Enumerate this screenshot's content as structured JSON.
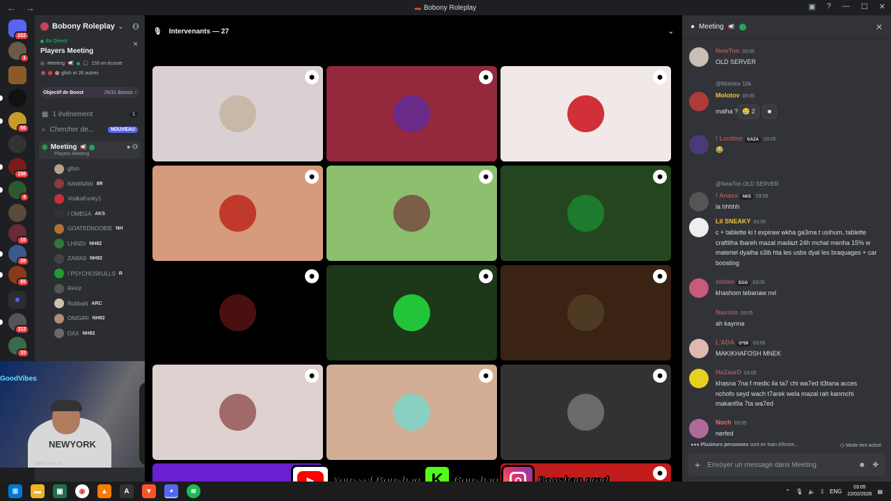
{
  "window": {
    "title": "Bobony Roleplay"
  },
  "server_rail": {
    "dm_badge": "222",
    "badges": [
      "1",
      "56",
      "158",
      "4",
      "10",
      "38",
      "55",
      "112",
      "33"
    ]
  },
  "sidebar": {
    "server_name": "Bobony Roleplay",
    "live": {
      "label": "En Direct",
      "title": "Players Meeting",
      "channel": "Meeting",
      "listeners": "155 en écoute",
      "participants": "gltxh et 26 autres"
    },
    "boost": {
      "label": "Objectif de Boost",
      "count": "25/31 Boosts"
    },
    "events": {
      "label": "1 événement",
      "count": "1"
    },
    "search": {
      "label": "Chercher de...",
      "badge": "NOUVEAU"
    },
    "voice_channel": {
      "name": "Meeting",
      "subtitle": "Players Meeting"
    },
    "voice_users": [
      {
        "name": "gltxh",
        "tag": "",
        "color": "#b9a08a"
      },
      {
        "name": "NAWNAW",
        "tag": "8R",
        "color": "#8a3b3b"
      },
      {
        "name": "VodkaFunky1",
        "tag": "",
        "color": "#c72f3a"
      },
      {
        "name": "! OMEGA",
        "tag": "AKS",
        "color": "#333333"
      },
      {
        "name": "GOATEDNOOBIE",
        "tag": "NH",
        "color": "#b07030"
      },
      {
        "name": "LHINDI",
        "tag": "NH82",
        "color": "#2d7b3b"
      },
      {
        "name": "ZAWA9",
        "tag": "NH82",
        "color": "#444444"
      },
      {
        "name": "! PSYCHOSKULLS",
        "tag": "R",
        "color": "#1e9e2e"
      },
      {
        "name": "Reviz",
        "tag": "",
        "color": "#555555"
      },
      {
        "name": "RobbaN",
        "tag": "ARC",
        "color": "#cfc1b0"
      },
      {
        "name": "ONIGIRI",
        "tag": "NH82",
        "color": "#ad8e7a"
      },
      {
        "name": "DAX",
        "tag": "NH82",
        "color": "#6a6a6a"
      }
    ]
  },
  "webcam": {
    "neon": "GoodVibes",
    "shirt": "NEWYORK",
    "status": "Dans une ca"
  },
  "stage": {
    "header": "Intervenants — 27",
    "tiles": [
      {
        "bg": "#d9d0d1",
        "av": "#c8b8a8"
      },
      {
        "bg": "#94283d",
        "av": "#6a2a8a"
      },
      {
        "bg": "#f1e9e7",
        "av": "#d13039"
      },
      {
        "bg": "#d69a7c",
        "av": "#c0392b"
      },
      {
        "bg": "#8cbf6e",
        "av": "#7a5e4a"
      },
      {
        "bg": "#24461f",
        "av": "#1e7a2e"
      },
      {
        "bg": "#000000",
        "av": "#4a0f0f"
      },
      {
        "bg": "#1d3818",
        "av": "#22c43a"
      },
      {
        "bg": "#3a2313",
        "av": "#4e3a22"
      },
      {
        "bg": "#ded1cf",
        "av": "#a06a6a"
      },
      {
        "bg": "#d4ad95",
        "av": "#8ad0c0"
      },
      {
        "bg": "#323232",
        "av": "#6a6a6a"
      }
    ]
  },
  "chat": {
    "title": "Meeting",
    "messages": [
      {
        "name": "NewTon",
        "color": "#a05a5a",
        "time": "03:05",
        "body": "OLD SERVER"
      },
      {
        "reply": "@Molotov 10k",
        "name": "Molotov",
        "color": "#f0c040",
        "time": "03:05",
        "body": "malha ?",
        "reaction": "🥲 2"
      },
      {
        "name": "! Lordino",
        "tag": "GAZA",
        "color": "#a05a5a",
        "time": "03:05",
        "body": "😂"
      },
      {
        "reply": "@NewTon OLD SERVER",
        "name": "! Anass",
        "tag": "AKS",
        "color": "#a05a5a",
        "time": "03:05",
        "body": "la hhhhh"
      },
      {
        "name": "Lil SNEAKY",
        "color": "#f0c040",
        "time": "03:05",
        "body": "c + tablette ki t expiraw wkha ga3ma t usihum, tablette craftitha lbareh mazal madazt 24h mchat menha 15% w materiel dyalha s3ib hta les usbs dyal les braquages + car boosting"
      },
      {
        "name": "zebiwi",
        "tag": "EGO",
        "color": "#a05a5a",
        "time": "03:05",
        "body": "khashom tebanaw nvl"
      },
      {
        "name": "Nassim",
        "color": "#a05a5a",
        "time": "03:05",
        "body": "ah  kaynna"
      },
      {
        "name": "L'ADA",
        "tag": "G*59",
        "color": "#a05a5a",
        "time": "03:05",
        "body": "MAKIKHAFOSH MNEK"
      },
      {
        "name": "HaZaarD",
        "color": "#a05a5a",
        "time": "03:05",
        "body": "khasna 7na f medic ila ta7 chi wa7ed it3tana acces nchofo seyd wach t7arek wela mazal rah kanmchi makanl9a 7ta wa7ed"
      },
      {
        "name": "Noch",
        "color": "#e86d6d",
        "time": "03:05",
        "body": "nerfed"
      }
    ],
    "typing": {
      "names": "Plusieurs personnes",
      "suffix": "sont en train d'écrire...",
      "slow": "Mode lent activé."
    },
    "composer_placeholder": "Envoyer un message dans Meeting"
  },
  "overlay": {
    "youtube": "Youssef Boushaq",
    "kick": "Boushaq",
    "instagram": "Boushaq.prod"
  },
  "taskbar": {
    "lang": "ENG",
    "time": "03:05",
    "date": "22/02/2026"
  }
}
